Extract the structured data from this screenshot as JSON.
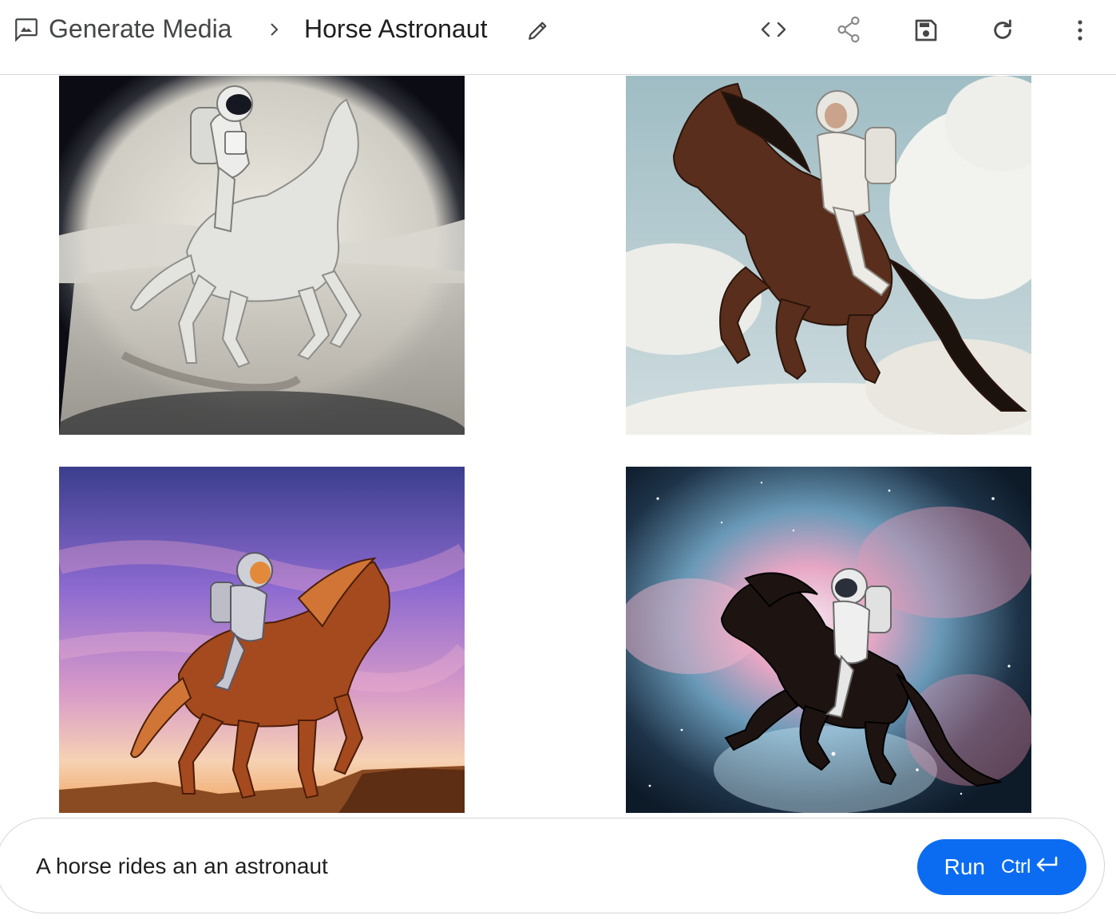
{
  "header": {
    "breadcrumb_root": "Generate Media",
    "title": "Horse Astronaut",
    "icons": {
      "app": "image-chat-icon",
      "separator": "chevron-right-icon",
      "edit": "pencil-icon",
      "code": "code-icon",
      "share": "share-icon",
      "save": "save-icon",
      "refresh": "refresh-icon",
      "more": "more-vert-icon"
    }
  },
  "images": [
    {
      "scene": "white horse with astronaut rider on desert sand, vignette"
    },
    {
      "scene": "brown horse leaping with astronaut rider in cloudy sky"
    },
    {
      "scene": "chestnut horse with astronaut rider at sunset"
    },
    {
      "scene": "black horse rearing with astronaut rider in nebula"
    }
  ],
  "prompt": {
    "value": "A horse rides an an astronaut",
    "run_label": "Run",
    "shortcut_label": "Ctrl",
    "shortcut_icon": "enter-arrow-icon"
  },
  "colors": {
    "accent": "#0b6cf2",
    "text": "#1f1f1f",
    "muted": "#444746"
  }
}
